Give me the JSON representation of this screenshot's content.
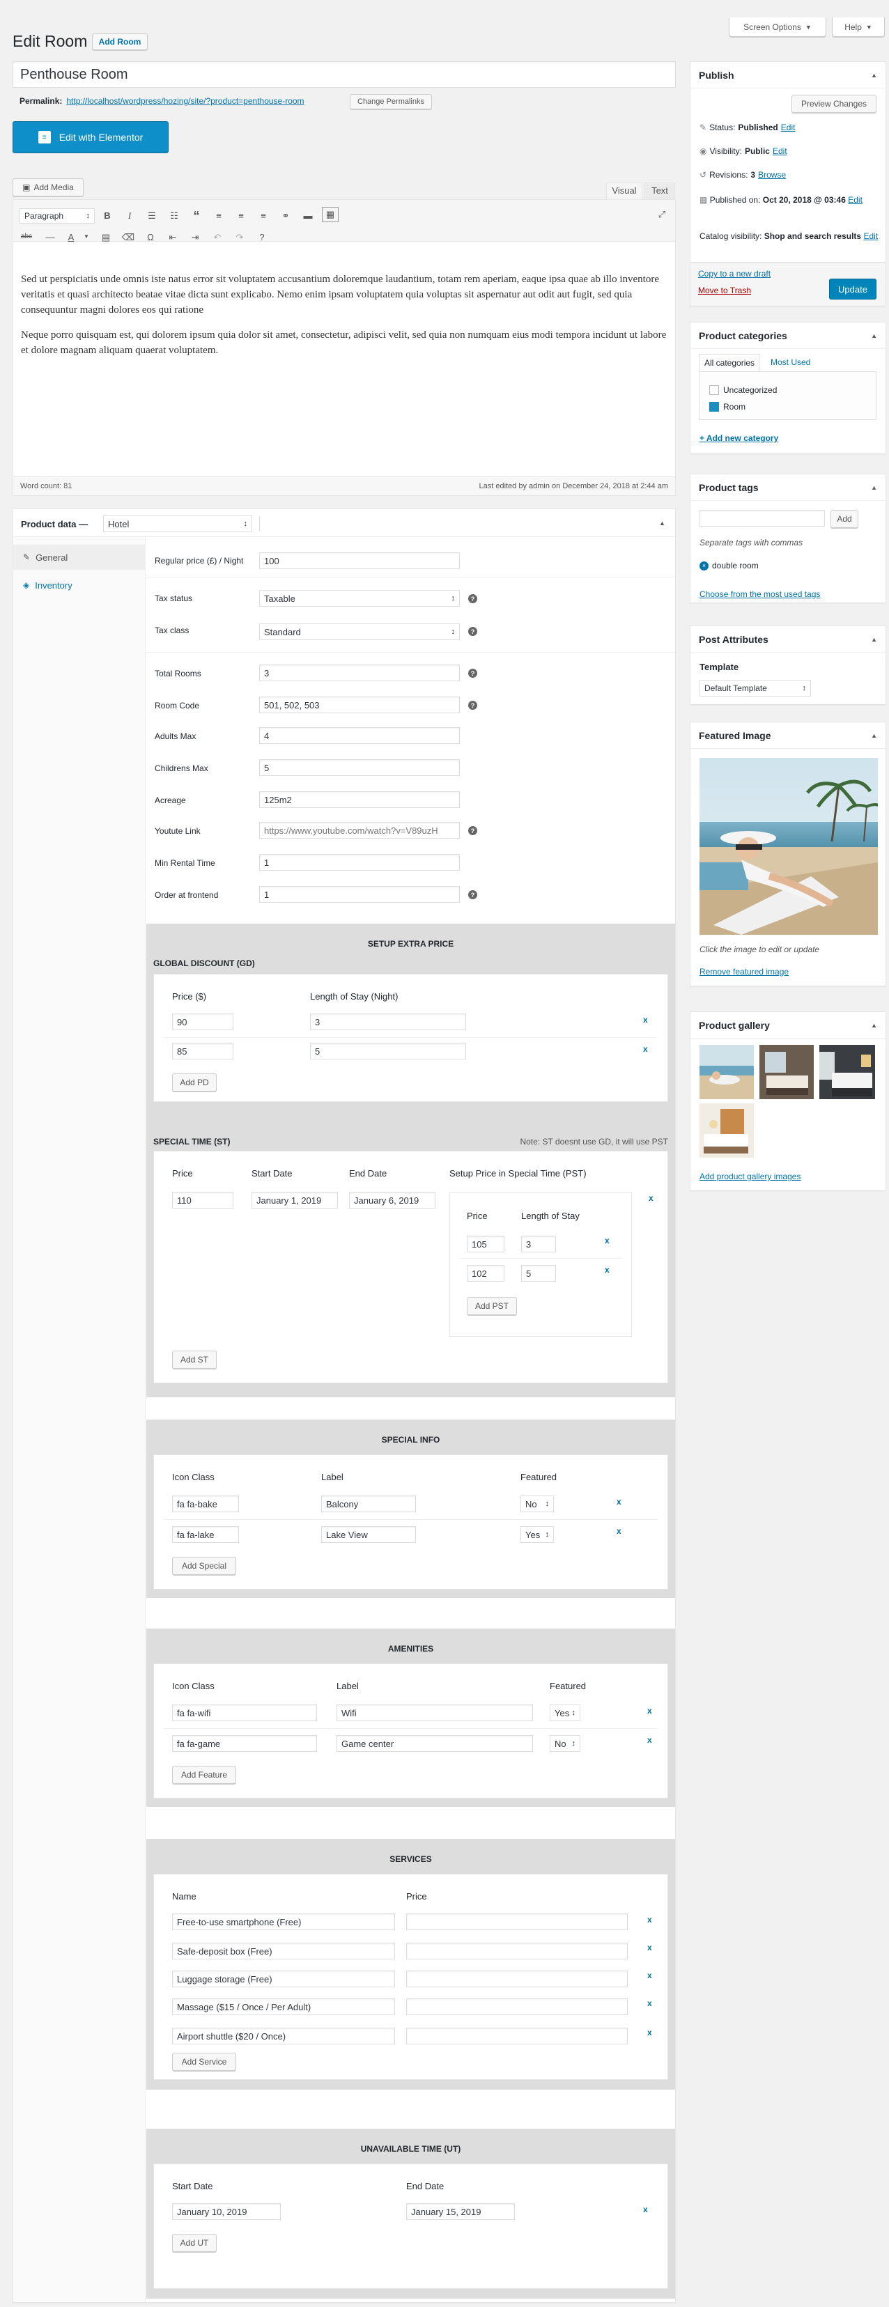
{
  "header": {
    "title": "Edit Room",
    "add_new": "Add Room",
    "screen_options": "Screen Options",
    "help": "Help"
  },
  "post": {
    "title": "Penthouse Room",
    "permalink_label": "Permalink:",
    "permalink": "http://localhost/wordpress/hozing/site/?product=penthouse-room",
    "change_permalinks": "Change Permalinks",
    "elementor": "Edit with Elementor"
  },
  "editor": {
    "add_media": "Add Media",
    "tab_visual": "Visual",
    "tab_text": "Text",
    "format": "Paragraph",
    "p1": "Sed ut perspiciatis unde omnis iste natus error sit voluptatem accusantium doloremque laudantium, totam rem aperiam, eaque ipsa quae ab illo inventore veritatis et quasi architecto beatae vitae dicta sunt explicabo. Nemo enim ipsam voluptatem quia voluptas sit aspernatur aut odit aut fugit, sed quia consequuntur magni dolores eos qui ratione",
    "p2": "Neque porro quisquam est, qui dolorem ipsum quia dolor sit amet, consectetur, adipisci velit, sed quia non numquam eius modi tempora incidunt ut labore et dolore magnam aliquam quaerat voluptatem.",
    "word_count": "Word count: 81",
    "last_edited": "Last edited by admin on December 24, 2018 at 2:44 am"
  },
  "product_data": {
    "label": "Product data —",
    "type": "Hotel",
    "tabs": [
      "General",
      "Inventory"
    ],
    "fields": [
      {
        "label": "Regular price (£) / Night",
        "value": "100"
      },
      {
        "label": "Tax status",
        "value": "Taxable"
      },
      {
        "label": "Tax class",
        "value": "Standard"
      },
      {
        "label": "Total Rooms",
        "value": "3"
      },
      {
        "label": "Room Code",
        "value": "501, 502, 503"
      },
      {
        "label": "Adults Max",
        "value": "4"
      },
      {
        "label": "Childrens Max",
        "value": "5"
      },
      {
        "label": "Acreage",
        "value": "125m2"
      },
      {
        "label": "Youtute Link",
        "value": "https://www.youtube.com/watch?v=V89uzH"
      },
      {
        "label": "Min Rental Time",
        "value": "1"
      },
      {
        "label": "Order at frontend",
        "value": "1"
      }
    ]
  },
  "extra_price": {
    "title": "SETUP EXTRA PRICE",
    "gd_title": "GLOBAL DISCOUNT (GD)",
    "col_price": "Price ($)",
    "col_stay": "Length of Stay (Night)",
    "rows": [
      {
        "price": "90",
        "stay": "3"
      },
      {
        "price": "85",
        "stay": "5"
      }
    ],
    "add_pd": "Add PD",
    "st_title": "SPECIAL TIME (ST)",
    "st_note": "Note: ST doesnt use GD, it will use PST",
    "st_cols": [
      "Price",
      "Start Date",
      "End Date",
      "Setup Price in Special Time (PST)"
    ],
    "st_row": {
      "price": "110",
      "start": "January 1, 2019",
      "end": "January 6, 2019"
    },
    "pst_cols": [
      "Price",
      "Length of Stay"
    ],
    "pst_rows": [
      {
        "price": "105",
        "stay": "3"
      },
      {
        "price": "102",
        "stay": "5"
      }
    ],
    "add_pst": "Add PST",
    "add_st": "Add ST"
  },
  "special_info": {
    "title": "SPECIAL INFO",
    "cols": [
      "Icon Class",
      "Label",
      "Featured"
    ],
    "rows": [
      {
        "icon": "fa fa-bake",
        "label": "Balcony",
        "featured": "No"
      },
      {
        "icon": "fa fa-lake",
        "label": "Lake View",
        "featured": "Yes"
      }
    ],
    "add": "Add Special"
  },
  "amenities": {
    "title": "AMENITIES",
    "cols": [
      "Icon Class",
      "Label",
      "Featured"
    ],
    "rows": [
      {
        "icon": "fa fa-wifi",
        "label": "Wifi",
        "featured": "Yes"
      },
      {
        "icon": "fa fa-game",
        "label": "Game center",
        "featured": "No"
      }
    ],
    "add": "Add Feature"
  },
  "services": {
    "title": "SERVICES",
    "cols": [
      "Name",
      "Price"
    ],
    "rows": [
      "Free-to-use smartphone (Free)",
      "Safe-deposit box (Free)",
      "Luggage storage (Free)",
      "Massage ($15 / Once / Per Adult)",
      "Airport shuttle ($20 / Once)"
    ],
    "add": "Add Service"
  },
  "unavailable": {
    "title": "UNAVAILABLE TIME (UT)",
    "cols": [
      "Start Date",
      "End Date"
    ],
    "row": {
      "start": "January 10, 2019",
      "end": "January 15, 2019"
    },
    "add": "Add UT"
  },
  "publish": {
    "title": "Publish",
    "preview": "Preview Changes",
    "status_label": "Status:",
    "status": "Published",
    "visibility_label": "Visibility:",
    "visibility": "Public",
    "revisions_label": "Revisions:",
    "revisions": "3",
    "browse": "Browse",
    "published_label": "Published on:",
    "published": "Oct 20, 2018 @ 03:46",
    "edit": "Edit",
    "catalog_label": "Catalog visibility:",
    "catalog": "Shop and search results",
    "copy_draft": "Copy to a new draft",
    "trash": "Move to Trash",
    "update": "Update"
  },
  "categories": {
    "title": "Product categories",
    "tab_all": "All categories",
    "tab_used": "Most Used",
    "items": [
      {
        "name": "Uncategorized",
        "checked": false
      },
      {
        "name": "Room",
        "checked": true
      }
    ],
    "add": "+ Add new category"
  },
  "tags": {
    "title": "Product tags",
    "add": "Add",
    "hint": "Separate tags with commas",
    "tag": "double room",
    "choose": "Choose from the most used tags"
  },
  "attributes": {
    "title": "Post Attributes",
    "template_label": "Template",
    "template": "Default Template"
  },
  "featured": {
    "title": "Featured Image",
    "hint": "Click the image to edit or update",
    "remove": "Remove featured image"
  },
  "gallery": {
    "title": "Product gallery",
    "add": "Add product gallery images"
  },
  "colors": {
    "accent": "#0073aa",
    "elementor": "#0e8fc9",
    "update": "#0085ba",
    "trash": "#a00"
  }
}
